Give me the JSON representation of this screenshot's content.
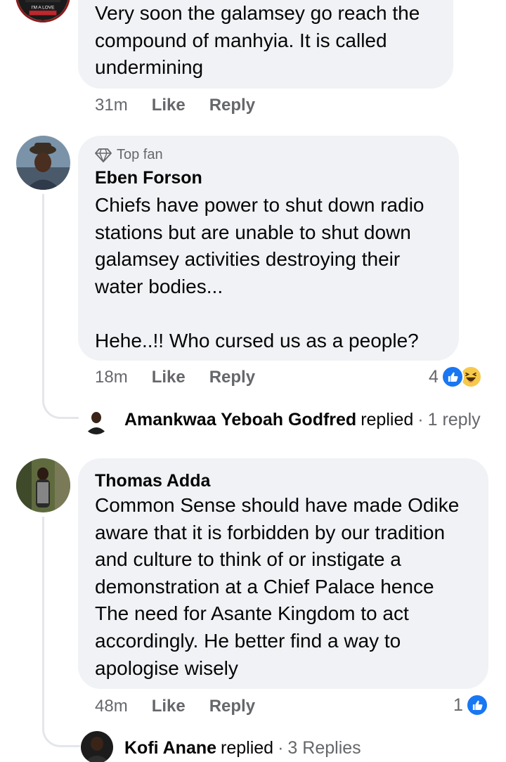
{
  "comments": [
    {
      "author": "",
      "avatar_badge_text": "I'M A LOVE",
      "text": "Very soon the galamsey go reach the\ncompound of manhyia. It is called\nundermining",
      "time": "31m",
      "like_label": "Like",
      "reply_label": "Reply"
    },
    {
      "badge": "Top fan",
      "badge_icon": "diamond-icon",
      "author": "Eben Forson",
      "text": "Chiefs have power to shut down radio\nstations but are unable to shut down\ngalamsey activities destroying their\nwater bodies...\n\nHehe..!! Who cursed us as a people?",
      "time": "18m",
      "like_label": "Like",
      "reply_label": "Reply",
      "reaction_count": "4",
      "reactions": [
        "like-icon",
        "haha-icon"
      ],
      "reply_summary": {
        "name": "Amankwaa Yeboah Godfred",
        "verb": "replied",
        "separator": "·",
        "count_label": "1 reply"
      }
    },
    {
      "author": "Thomas Adda",
      "text": "Common Sense should have made Odike\naware that it is forbidden by our tradition\nand culture to think of or instigate a\ndemonstration at a Chief Palace hence\nThe need for Asante Kingdom to act\naccordingly. He better find a way to\napologise wisely",
      "time": "48m",
      "like_label": "Like",
      "reply_label": "Reply",
      "reaction_count": "1",
      "reactions": [
        "like-icon"
      ],
      "reply_summary": {
        "name": "Kofi Anane",
        "verb": "replied",
        "separator": "·",
        "count_label": "3 Replies"
      }
    }
  ],
  "colors": {
    "bubble": "#f0f2f5",
    "secondary_text": "#65676b",
    "like_blue": "#1877f2",
    "haha_yellow": "#f7c94a",
    "thread_line": "#e4e6eb"
  }
}
